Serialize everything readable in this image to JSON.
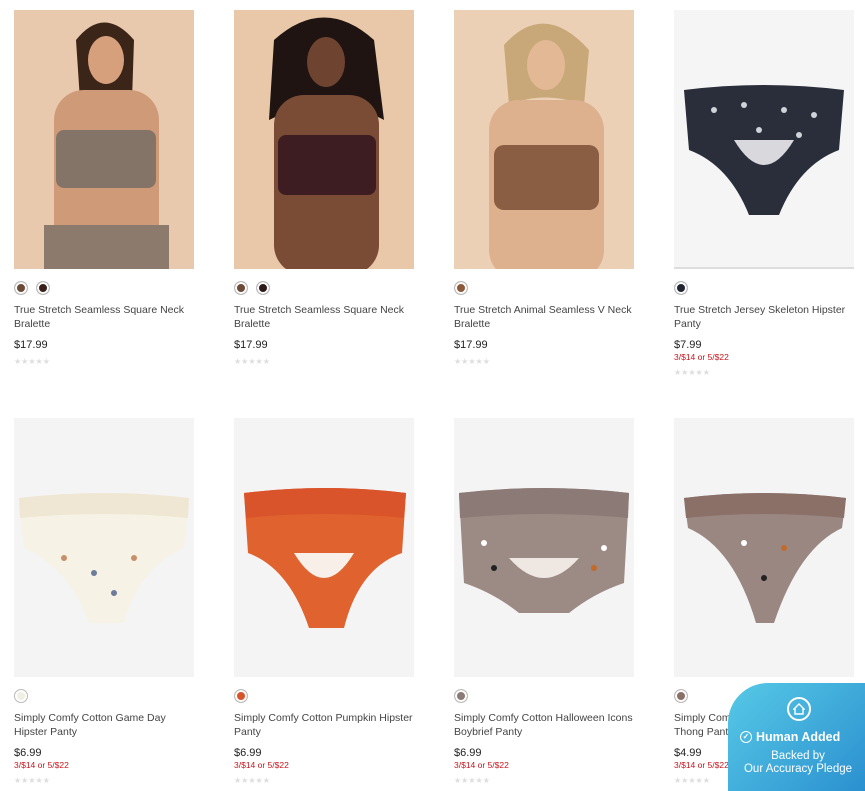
{
  "products": [
    {
      "name": "True Stretch Seamless Square Neck Bralette",
      "price": "$17.99",
      "promo": "",
      "swatches": [
        "#6b4a38",
        "#3a1f1a"
      ],
      "image": "woman-taupe-bralette",
      "rating": "★★★★★"
    },
    {
      "name": "True Stretch Seamless Square Neck Bralette",
      "price": "$17.99",
      "promo": "",
      "swatches": [
        "#6b4a38",
        "#2e1a1a"
      ],
      "image": "woman-plum-bralette",
      "rating": "★★★★★"
    },
    {
      "name": "True Stretch Animal Seamless V Neck Bralette",
      "price": "$17.99",
      "promo": "",
      "swatches": [
        "#8a5a3a"
      ],
      "image": "woman-brown-bralette",
      "rating": "★★★★★"
    },
    {
      "name": "True Stretch Jersey Skeleton Hipster Panty",
      "price": "$7.99",
      "promo": "3/$14 or 5/$22",
      "swatches": [
        "#222533"
      ],
      "image": "navy-skeleton-panty",
      "rating": "★★★★★"
    },
    {
      "name": "Simply Comfy Cotton Game Day Hipster Panty",
      "price": "$6.99",
      "promo": "3/$14 or 5/$22",
      "swatches": [
        "#f2eee2"
      ],
      "image": "cream-gameday-panty",
      "rating": "★★★★★"
    },
    {
      "name": "Simply Comfy Cotton Pumpkin Hipster Panty",
      "price": "$6.99",
      "promo": "3/$14 or 5/$22",
      "swatches": [
        "#d9542a"
      ],
      "image": "orange-pumpkin-panty",
      "rating": "★★★★★"
    },
    {
      "name": "Simply Comfy Cotton Halloween Icons Boybrief Panty",
      "price": "$6.99",
      "promo": "3/$14 or 5/$22",
      "swatches": [
        "#8b7a75"
      ],
      "image": "mauve-halloween-boybrief",
      "rating": "★★★★★"
    },
    {
      "name": "Simply Comfy Cotton Halloween Icons Thong Panty",
      "price": "$4.99",
      "promo": "3/$14 or 5/$22",
      "swatches": [
        "#8b7068"
      ],
      "image": "mauve-halloween-thong",
      "rating": "★★★★★"
    }
  ],
  "badge": {
    "title": "Human Added",
    "line1": "Backed by",
    "line2": "Our Accuracy Pledge",
    "icon": "home-icon"
  }
}
